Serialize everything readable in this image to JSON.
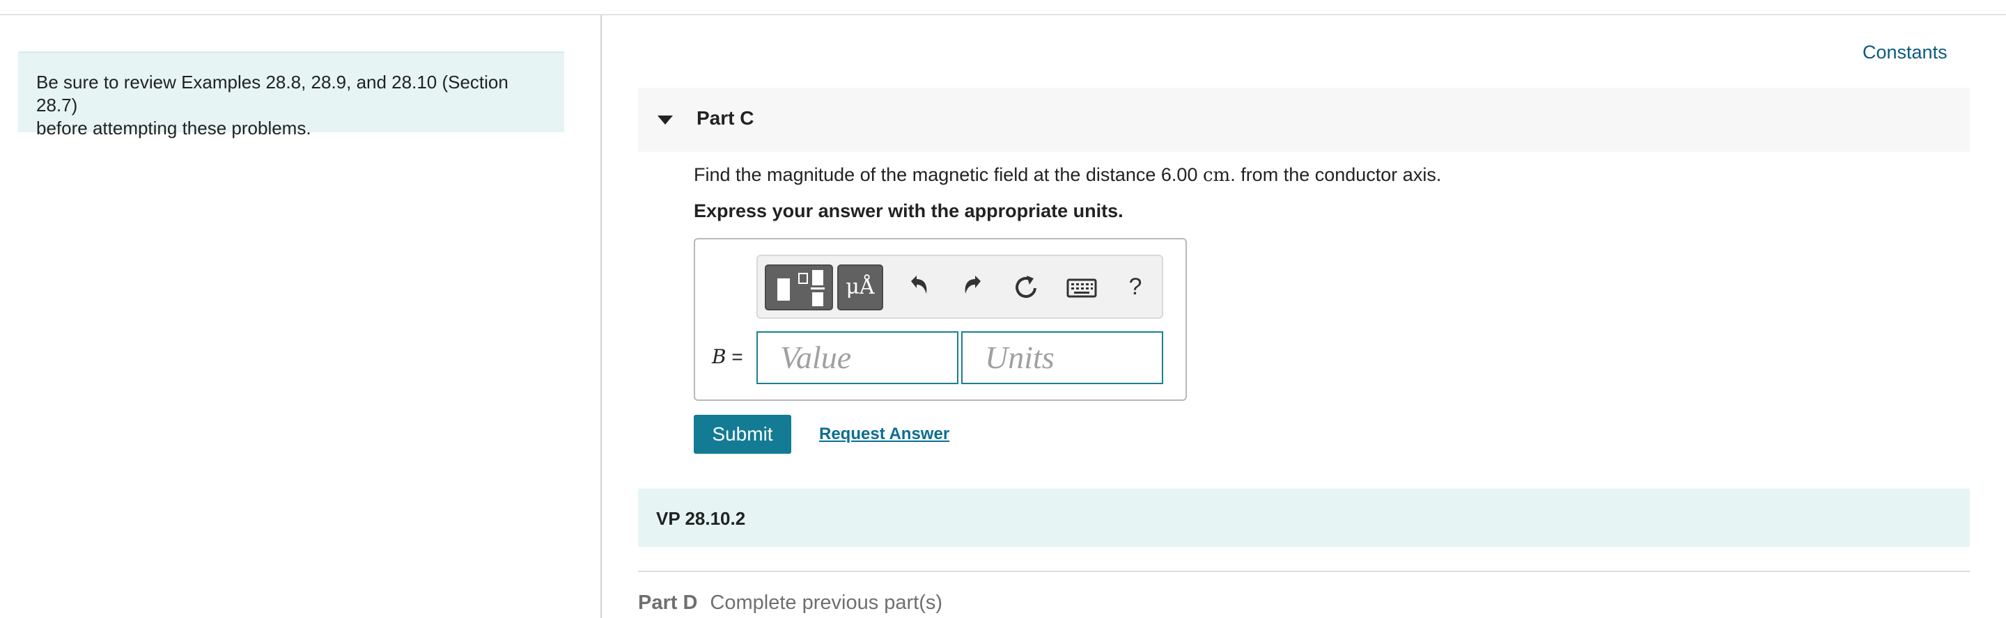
{
  "sidebar": {
    "note_line1": "Be sure to review Examples 28.8, 28.9, and 28.10 (Section 28.7)",
    "note_line2": "before attempting these problems."
  },
  "header": {
    "constants_link": "Constants"
  },
  "part_c": {
    "title": "Part C",
    "question_prefix": "Find the magnitude of the magnetic field at the distance 6.00 ",
    "question_unit": "cm",
    "question_suffix": ". from the conductor axis.",
    "instruction": "Express your answer with the appropriate units.",
    "toolbar": {
      "units_symbol": "μÅ",
      "help_symbol": "?"
    },
    "answer": {
      "variable": "B",
      "equals": " =",
      "value_placeholder": "Value",
      "units_placeholder": "Units"
    },
    "submit_label": "Submit",
    "request_answer_label": "Request Answer"
  },
  "vp_section": {
    "title": "VP 28.10.2"
  },
  "part_d": {
    "label": "Part D",
    "status": "Complete previous part(s)"
  },
  "colors": {
    "accent": "#137b94",
    "link": "#0b5a80",
    "note_bg": "#e6f4f4",
    "field_border": "#1a7f91"
  }
}
